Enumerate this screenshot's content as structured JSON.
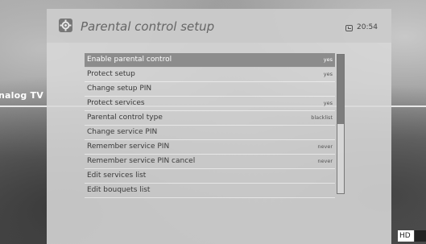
{
  "background": {
    "side_label": "nalog TV"
  },
  "header": {
    "title": "Parental control setup",
    "icon": "gear-icon",
    "time": "20:54"
  },
  "menu": {
    "items": [
      {
        "label": "Enable parental control",
        "value": "yes",
        "selected": true
      },
      {
        "label": "Protect setup",
        "value": "yes"
      },
      {
        "label": "Change setup PIN",
        "value": ""
      },
      {
        "label": "Protect services",
        "value": "yes"
      },
      {
        "label": "Parental control type",
        "value": "blacklist"
      },
      {
        "label": "Change service PIN",
        "value": ""
      },
      {
        "label": "Remember service PIN",
        "value": "never"
      },
      {
        "label": "Remember service PIN cancel",
        "value": "never"
      },
      {
        "label": "Edit services list",
        "value": ""
      },
      {
        "label": "Edit bouquets list",
        "value": ""
      }
    ]
  },
  "scrollbar": {
    "position_fraction": 0.0,
    "visible_fraction": 0.5
  },
  "badge": {
    "label": "HD"
  },
  "colors": {
    "panel": "#d7d7d7",
    "selected_row": "#8c8c8c",
    "title": "#666666"
  }
}
